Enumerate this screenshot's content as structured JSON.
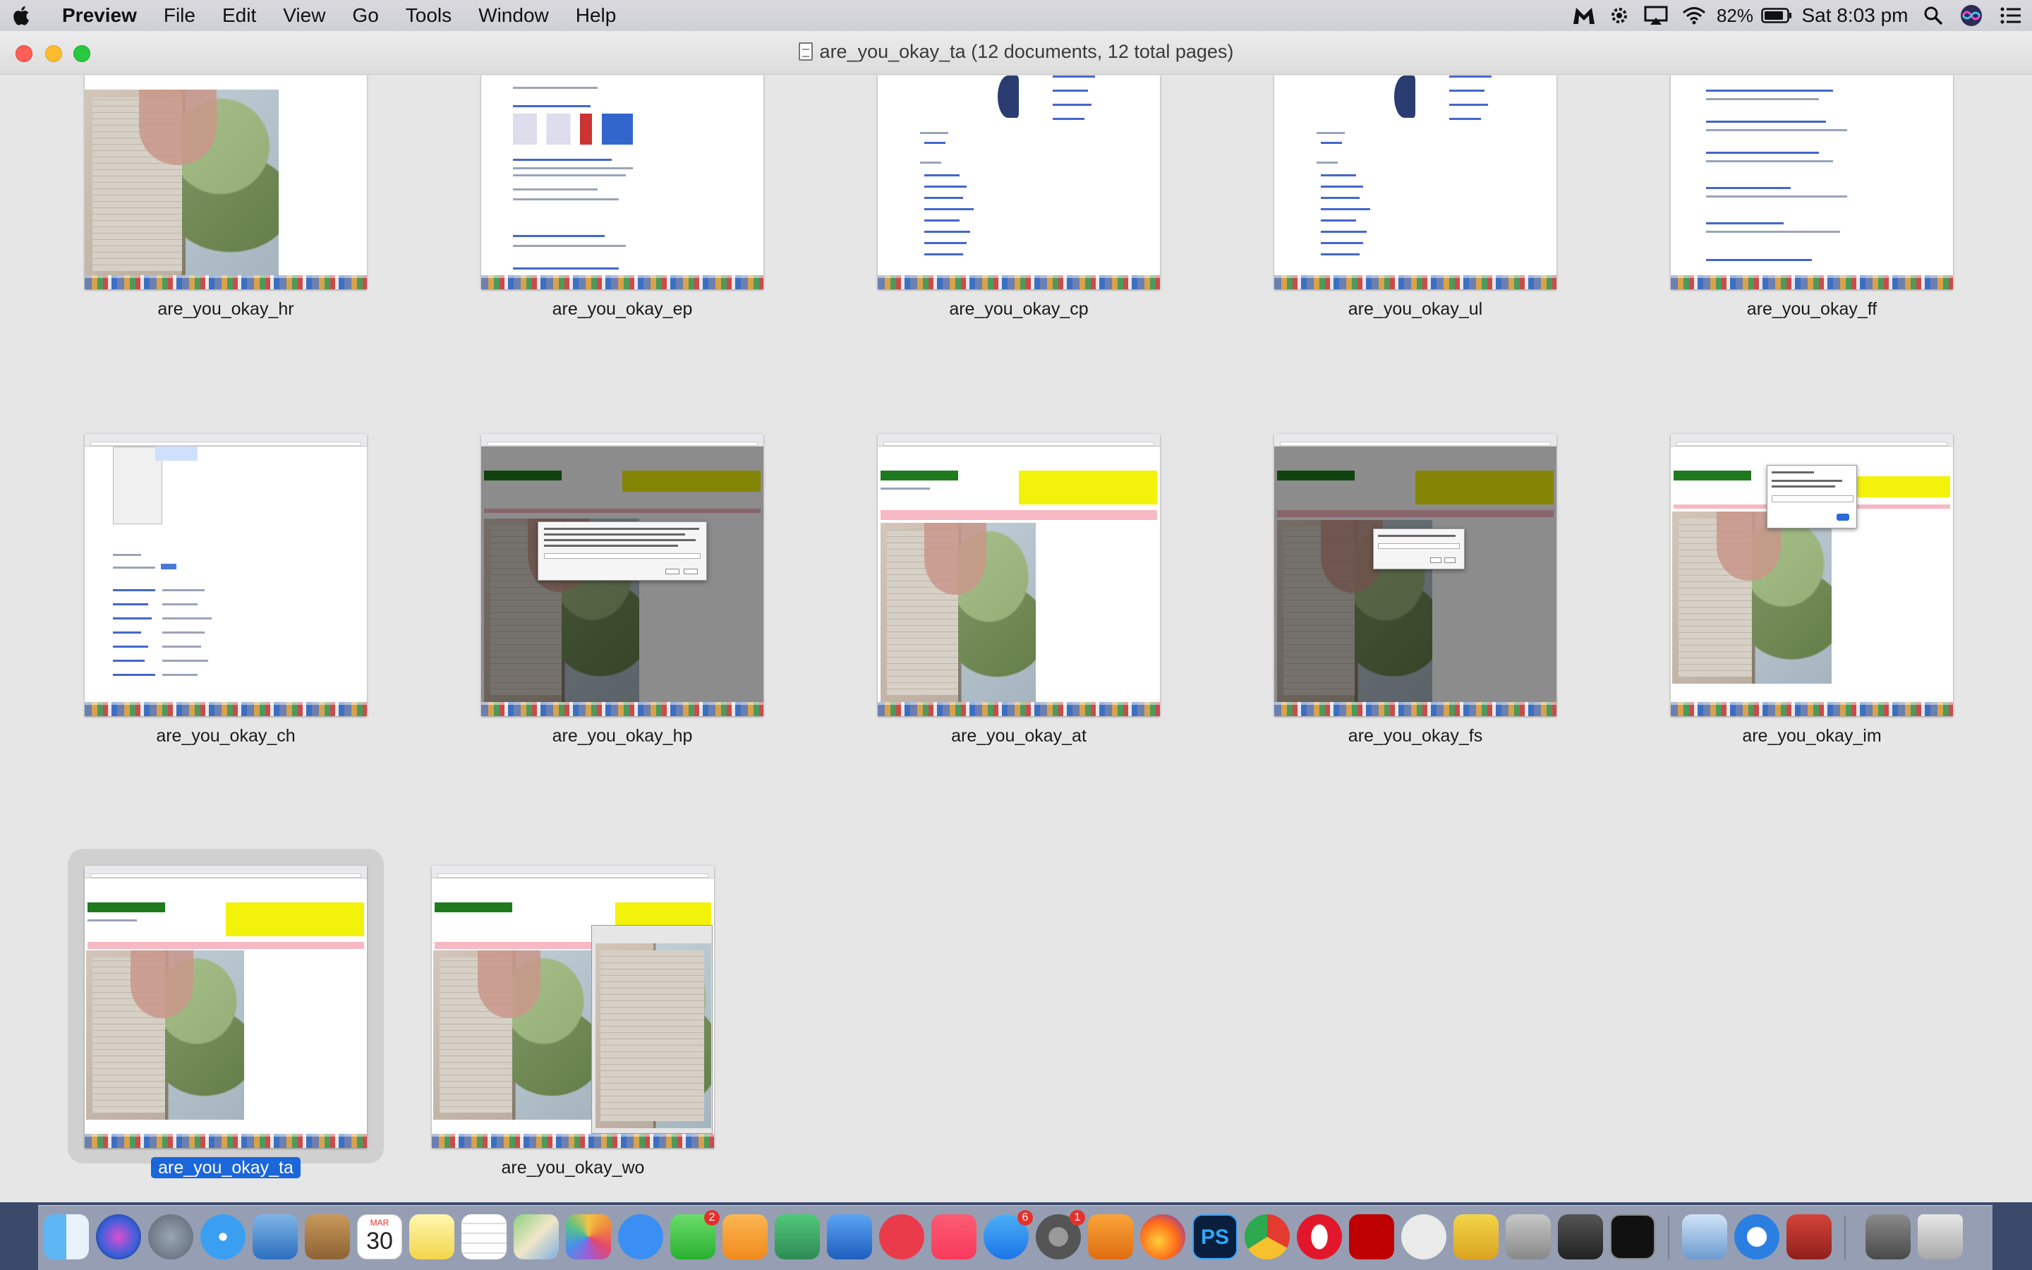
{
  "menubar": {
    "app_name": "Preview",
    "items": [
      "File",
      "Edit",
      "View",
      "Go",
      "Tools",
      "Window",
      "Help"
    ],
    "battery_percent": "82%",
    "clock": "Sat 8:03 pm"
  },
  "window": {
    "title": "are_you_okay_ta (12 documents, 12 total pages)"
  },
  "documents": [
    {
      "name": "are_you_okay_hr",
      "kind": "photo"
    },
    {
      "name": "are_you_okay_ep",
      "kind": "search"
    },
    {
      "name": "are_you_okay_cp",
      "kind": "wiki"
    },
    {
      "name": "are_you_okay_ul",
      "kind": "wiki"
    },
    {
      "name": "are_you_okay_ff",
      "kind": "search"
    },
    {
      "name": "are_you_okay_ch",
      "kind": "chrome-menu"
    },
    {
      "name": "are_you_okay_hp",
      "kind": "dialog"
    },
    {
      "name": "are_you_okay_at",
      "kind": "app"
    },
    {
      "name": "are_you_okay_fs",
      "kind": "dialog"
    },
    {
      "name": "are_you_okay_im",
      "kind": "dialog"
    },
    {
      "name": "are_you_okay_ta",
      "kind": "app",
      "selected": true
    },
    {
      "name": "are_you_okay_wo",
      "kind": "app-photo"
    }
  ],
  "dock": {
    "calendar_month": "MAR",
    "calendar_day": "30",
    "badges": {
      "facetime": "2",
      "app_store": "6",
      "system_preferences": "1"
    },
    "photoshop_label": "PS",
    "icons": [
      "finder-icon",
      "siri-icon",
      "launchpad-icon",
      "safari-icon",
      "mail-icon",
      "notes-icon",
      "calendar-icon",
      "stickies-icon",
      "reminders-icon",
      "maps-icon",
      "photos-icon",
      "messages-icon",
      "facetime-icon",
      "pages-icon",
      "numbers-icon",
      "keynote-icon",
      "news-icon",
      "music-icon",
      "app-store-icon",
      "system-preferences-icon",
      "audacity-icon",
      "firefox-icon",
      "photoshop-icon",
      "chrome-icon",
      "opera-icon",
      "filezilla-icon",
      "gimp-icon",
      "bbedit-icon",
      "paintbrush-icon",
      "inkscape-icon",
      "terminal-icon",
      "preview-icon",
      "quicktime-icon",
      "photobooth-icon",
      "downloads-icon",
      "trash-icon"
    ]
  }
}
